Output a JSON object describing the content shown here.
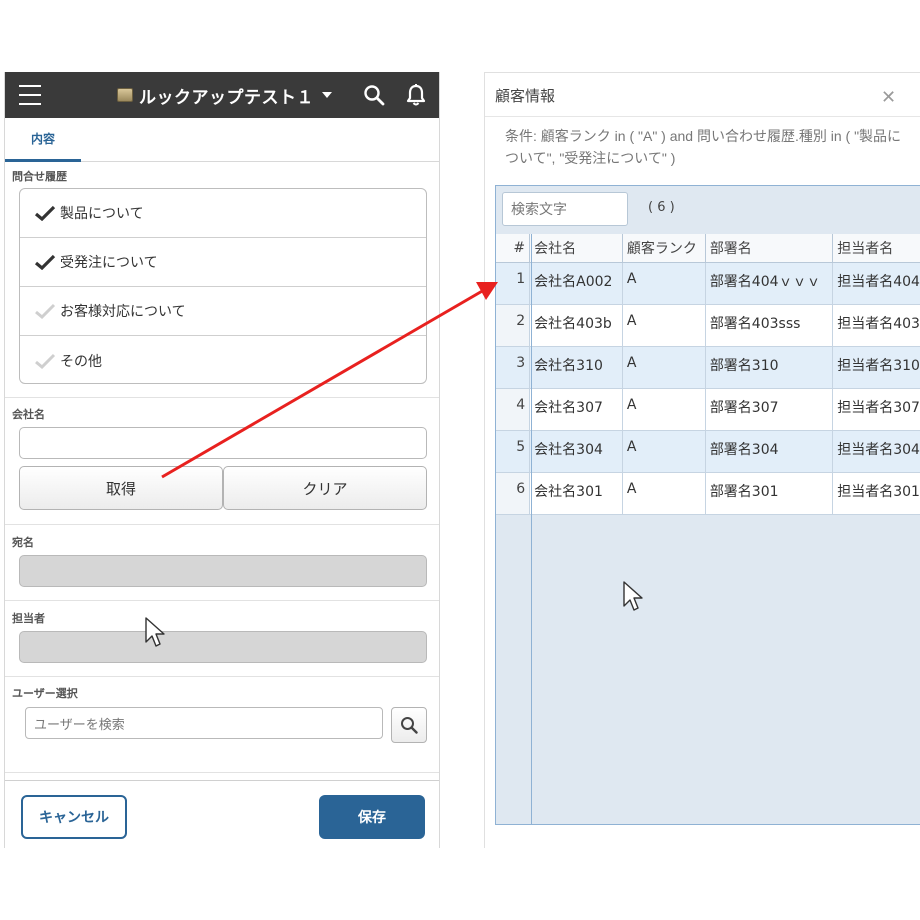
{
  "mobile": {
    "header": {
      "title": "ルックアップテスト１"
    },
    "tabs": [
      {
        "label": "内容"
      }
    ],
    "inquiry_history": {
      "label": "問合せ履歴",
      "options": [
        {
          "label": "製品について",
          "checked": true
        },
        {
          "label": "受発注について",
          "checked": true
        },
        {
          "label": "お客様対応について",
          "checked": false
        },
        {
          "label": "その他",
          "checked": false
        }
      ]
    },
    "company": {
      "label": "会社名",
      "value": "",
      "get_button": "取得",
      "clear_button": "クリア"
    },
    "addressee": {
      "label": "宛名",
      "value": ""
    },
    "contact": {
      "label": "担当者",
      "value": ""
    },
    "user_select": {
      "label": "ユーザー選択",
      "placeholder": "ユーザーを検索"
    },
    "footer": {
      "cancel_label": "キャンセル",
      "save_label": "保存"
    }
  },
  "dialog": {
    "title": "顧客情報",
    "close_icon": "close-icon",
    "condition": "条件: 顧客ランク in ( \"A\" ) and 問い合わせ履歴.種別 in ( \"製品について\", \"受発注について\" )",
    "search_placeholder": "検索文字",
    "count": "( 6 )",
    "columns": [
      "#",
      "会社名",
      "顧客ランク",
      "部署名",
      "担当者名"
    ],
    "rows": [
      {
        "num": "1",
        "company": "会社名A002",
        "rank": "A",
        "dept": "部署名404ｖｖｖ",
        "person": "担当者名404"
      },
      {
        "num": "2",
        "company": "会社名403b",
        "rank": "A",
        "dept": "部署名403sss",
        "person": "担当者名403"
      },
      {
        "num": "3",
        "company": "会社名310",
        "rank": "A",
        "dept": "部署名310",
        "person": "担当者名310"
      },
      {
        "num": "4",
        "company": "会社名307",
        "rank": "A",
        "dept": "部署名307",
        "person": "担当者名307"
      },
      {
        "num": "5",
        "company": "会社名304",
        "rank": "A",
        "dept": "部署名304",
        "person": "担当者名304"
      },
      {
        "num": "6",
        "company": "会社名301",
        "rank": "A",
        "dept": "部署名301",
        "person": "担当者名301"
      }
    ]
  },
  "colors": {
    "topbar": "#3a3a3a",
    "accent": "#2a6496",
    "grid_bg": "#dfe8f1",
    "selected_row": "#e2eef9",
    "arrow": "#e8211f"
  }
}
